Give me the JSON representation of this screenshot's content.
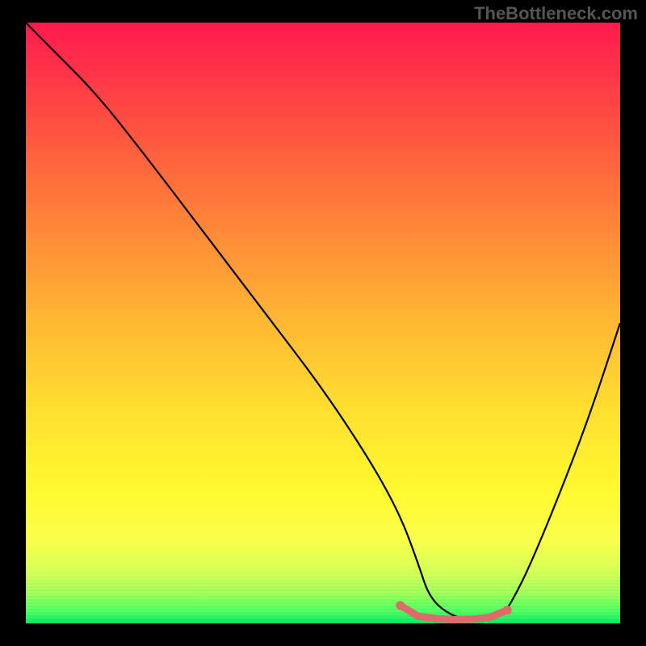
{
  "watermark": "TheBottleneck.com",
  "chart_data": {
    "type": "line",
    "title": "",
    "xlabel": "",
    "ylabel": "",
    "xlim": [
      0,
      100
    ],
    "ylim": [
      0,
      100
    ],
    "series": [
      {
        "name": "bottleneck-curve",
        "x": [
          0,
          5,
          12,
          20,
          30,
          40,
          50,
          58,
          63,
          66,
          68,
          72,
          76,
          80,
          82,
          85,
          90,
          95,
          100
        ],
        "y": [
          100,
          95,
          88,
          78,
          65,
          52,
          39,
          27,
          18,
          10,
          4,
          1,
          0.5,
          1,
          4,
          10,
          22,
          35,
          50
        ]
      }
    ],
    "highlight": {
      "name": "optimal-range",
      "x": [
        63,
        66,
        69,
        72,
        75,
        78,
        81
      ],
      "y": [
        3,
        1.2,
        0.8,
        0.6,
        0.7,
        1.0,
        2.2
      ],
      "color": "#e06a6a"
    },
    "gradient_stops": [
      {
        "pos": 0,
        "color": "#ff1a4d"
      },
      {
        "pos": 8,
        "color": "#ff3348"
      },
      {
        "pos": 20,
        "color": "#ff5a3f"
      },
      {
        "pos": 35,
        "color": "#ff8a38"
      },
      {
        "pos": 50,
        "color": "#ffb833"
      },
      {
        "pos": 65,
        "color": "#ffe030"
      },
      {
        "pos": 78,
        "color": "#fff92f"
      },
      {
        "pos": 86,
        "color": "#faff4a"
      },
      {
        "pos": 91,
        "color": "#d8ff55"
      },
      {
        "pos": 95,
        "color": "#9cff5a"
      },
      {
        "pos": 98,
        "color": "#4cff60"
      },
      {
        "pos": 100,
        "color": "#00e65e"
      }
    ]
  }
}
